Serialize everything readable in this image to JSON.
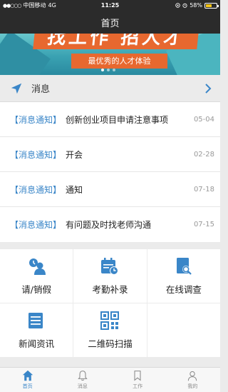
{
  "status_bar": {
    "carrier": "中国移动",
    "network": "4G",
    "time": "11:25",
    "battery": "58%"
  },
  "nav": {
    "title": "首页"
  },
  "banner": {
    "headline": "找工作 招人才",
    "slogan": "最优秀的人才体验"
  },
  "messages": {
    "section_title": "消息",
    "items": [
      {
        "tag": "【消息通知】",
        "title": "创新创业项目申请注意事项",
        "date": "05-04"
      },
      {
        "tag": "【消息通知】",
        "title": "开会",
        "date": "02-28"
      },
      {
        "tag": "【消息通知】",
        "title": "通知",
        "date": "07-18"
      },
      {
        "tag": "【消息通知】",
        "title": "有问题及时找老师沟通",
        "date": "07-15"
      }
    ]
  },
  "functions": [
    {
      "label": "请/销假",
      "icon": "leave-request-icon"
    },
    {
      "label": "考勤补录",
      "icon": "attendance-icon"
    },
    {
      "label": "在线调查",
      "icon": "survey-icon"
    },
    {
      "label": "新闻资讯",
      "icon": "news-icon"
    },
    {
      "label": "二维码扫描",
      "icon": "qr-code-icon"
    }
  ],
  "tabs": [
    {
      "label": "首页",
      "icon": "home-icon",
      "active": true
    },
    {
      "label": "消息",
      "icon": "bell-icon",
      "active": false
    },
    {
      "label": "工作",
      "icon": "bookmark-icon",
      "active": false
    },
    {
      "label": "我的",
      "icon": "user-icon",
      "active": false
    }
  ],
  "colors": {
    "accent": "#3a86c8",
    "bar": "#2b2b2b",
    "banner_orange": "#e7682f",
    "banner_teal": "#3aa2b2"
  }
}
